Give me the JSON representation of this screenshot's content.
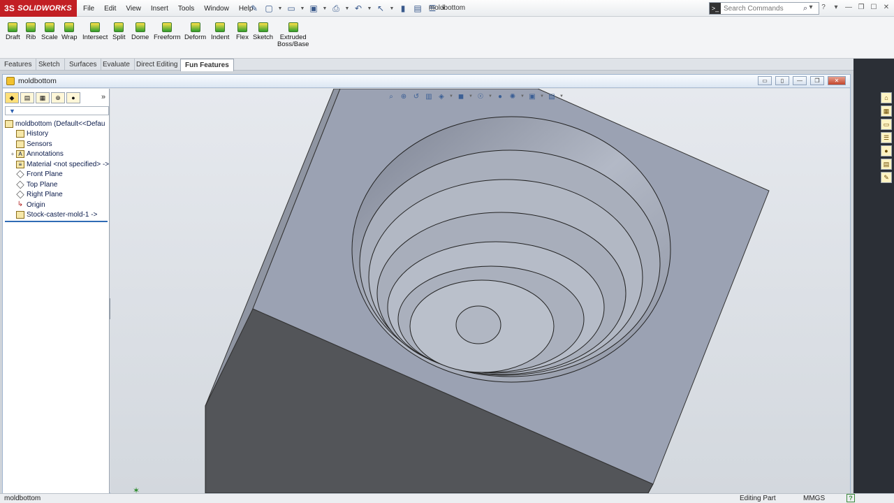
{
  "app": {
    "brand": "SOLIDWORKS",
    "brand_mark": "3S",
    "document_title": "moldbottom"
  },
  "menu": [
    "File",
    "Edit",
    "View",
    "Insert",
    "Tools",
    "Window",
    "Help"
  ],
  "search": {
    "placeholder": "Search Commands"
  },
  "commands": [
    {
      "label": "Draft"
    },
    {
      "label": "Rib"
    },
    {
      "label": "Scale"
    },
    {
      "label": "Wrap"
    },
    {
      "label": "Intersect"
    },
    {
      "label": "Split"
    },
    {
      "label": "Dome"
    },
    {
      "label": "Freeform"
    },
    {
      "label": "Deform"
    },
    {
      "label": "Indent"
    },
    {
      "label": "Flex"
    },
    {
      "label": "Sketch"
    },
    {
      "label": "Extruded",
      "label2": "Boss/Base"
    }
  ],
  "tabs": [
    "Features",
    "Sketch",
    "Surfaces",
    "Evaluate",
    "Direct Editing",
    "Fun Features"
  ],
  "active_tab": "Fun Features",
  "document": {
    "name": "moldbottom"
  },
  "feature_tree": {
    "root": "moldbottom  (Default<<Defau",
    "items": [
      {
        "label": "History",
        "icon": "history-icon"
      },
      {
        "label": "Sensors",
        "icon": "sensor-icon"
      },
      {
        "label": "Annotations",
        "icon": "annotation-icon",
        "expandable": true
      },
      {
        "label": "Material <not specified> ->",
        "icon": "material-icon"
      },
      {
        "label": "Front Plane",
        "icon": "plane-icon"
      },
      {
        "label": "Top Plane",
        "icon": "plane-icon"
      },
      {
        "label": "Right Plane",
        "icon": "plane-icon"
      },
      {
        "label": "Origin",
        "icon": "origin-icon"
      },
      {
        "label": "Stock-caster-mold-1 ->",
        "icon": "part-feature-icon"
      }
    ]
  },
  "status": {
    "document": "moldbottom",
    "mode": "Editing Part",
    "units": "MMGS",
    "help": "?"
  },
  "colors": {
    "brand_red": "#c21f24",
    "model_face": "#9ba2b3",
    "model_dark_side": "#535559",
    "tree_text": "#0a1a4a"
  }
}
